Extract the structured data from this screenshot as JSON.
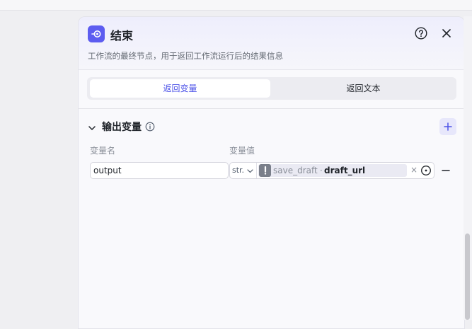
{
  "panel": {
    "title": "结束",
    "description": "工作流的最终节点，用于返回工作流运行后的结果信息",
    "node_icon": "exit-node-icon",
    "header_icons": {
      "help": "help-circle-icon",
      "close": "close-icon"
    }
  },
  "tabs": [
    {
      "label": "返回变量",
      "active": true
    },
    {
      "label": "返回文本",
      "active": false
    }
  ],
  "output_section": {
    "title": "输出变量",
    "columns": {
      "name": "变量名",
      "value": "变量值"
    },
    "rows": [
      {
        "name": "output",
        "type": "str.",
        "ref_node": "save_draft",
        "ref_separator": "·",
        "ref_var": "draft_url"
      }
    ]
  },
  "colors": {
    "accent": "#4d53e8",
    "icon_bg": "#5c5cf0"
  }
}
